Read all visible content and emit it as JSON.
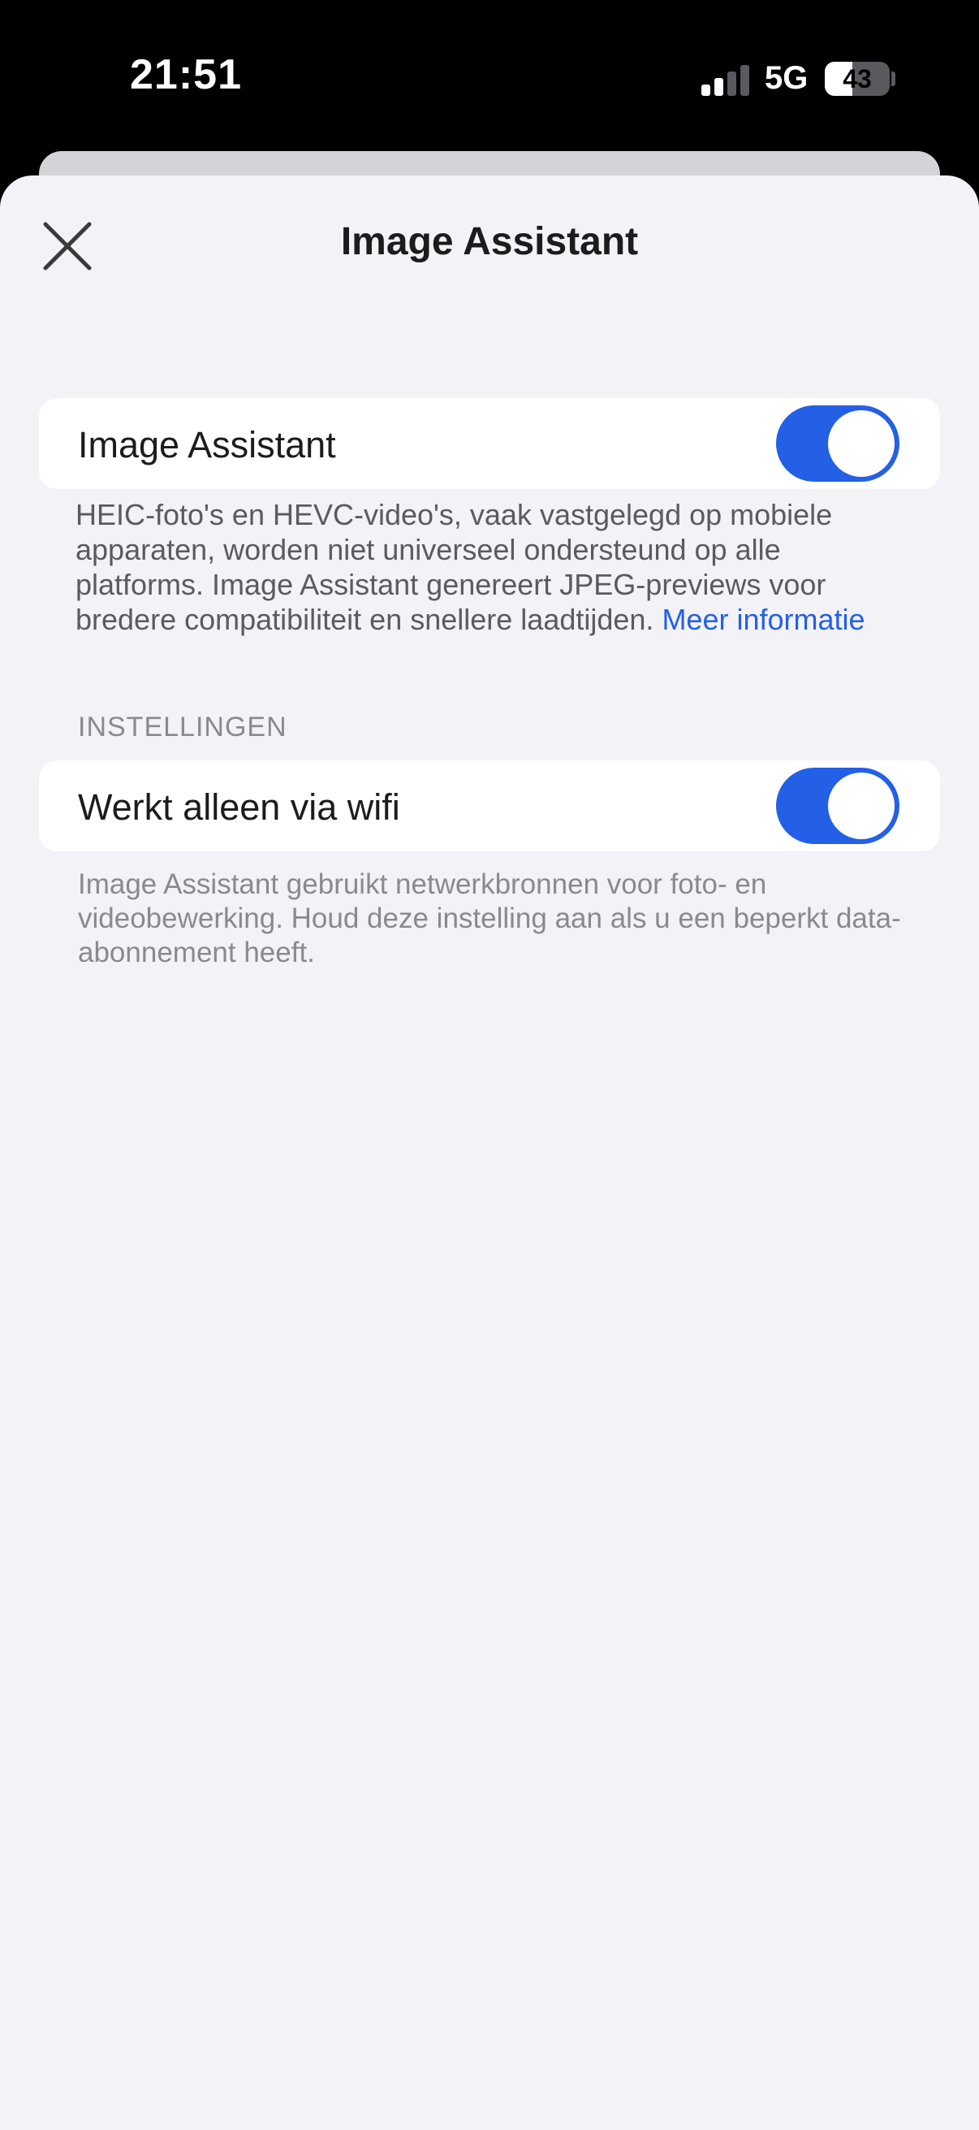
{
  "status_bar": {
    "time": "21:51",
    "network": "5G",
    "battery_percent": "43",
    "battery_level": 0.43,
    "signal_bars_active": 2,
    "signal_bars_total": 4
  },
  "header": {
    "title": "Image Assistant",
    "close_icon": "close-icon"
  },
  "image_assistant_toggle": {
    "label": "Image Assistant",
    "enabled": true
  },
  "description": {
    "text": "HEIC-foto's en HEVC-video's, vaak vastgelegd op mobiele apparaten, worden niet universeel ondersteund op alle platforms. Image Assistant genereert JPEG-previews voor bredere compatibiliteit en snellere laadtijden. ",
    "link_text": "Meer informatie"
  },
  "settings_section": {
    "header": "INSTELLINGEN",
    "wifi_only": {
      "label": "Werkt alleen via wifi",
      "enabled": true
    },
    "footer": "Image Assistant gebruikt netwerkbronnen voor foto- en videobewerking. Houd deze instelling aan als u een beperkt data-abonnement heeft."
  },
  "colors": {
    "accent": "#2460e5",
    "background": "#f2f2f7",
    "card": "#ffffff"
  }
}
